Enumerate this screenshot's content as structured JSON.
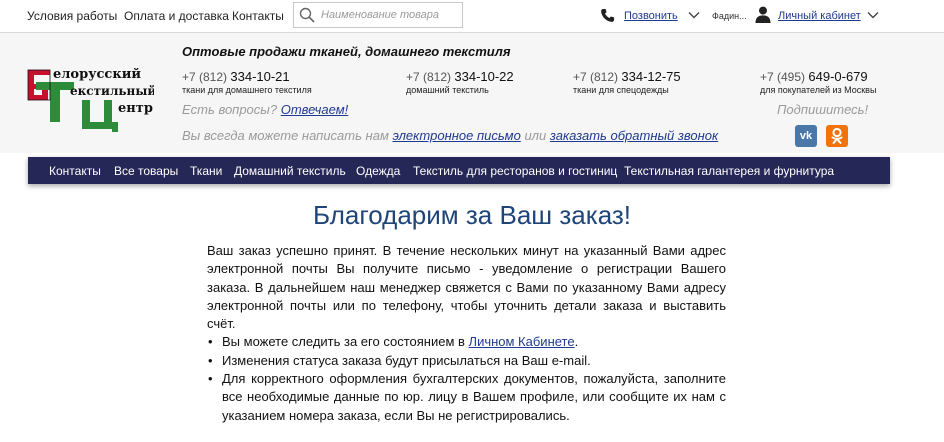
{
  "top_nav": {
    "links": [
      "Условия работы",
      "Оплата и доставка",
      "Контакты"
    ],
    "search_placeholder": "Наименование товара",
    "callback_label": "Позвонить",
    "user_name": "Фадин...",
    "cabinet_label": "Личный кабинет"
  },
  "header": {
    "logo_text": [
      "елорусский",
      "екстильный",
      "ентр"
    ],
    "tagline": "Оптовые продажи тканей, домашнего текстиля",
    "phones": [
      {
        "prefix": "+7 (812)",
        "number": "334-10-21",
        "desc": "ткани для домашнего текстиля"
      },
      {
        "prefix": "+7 (812)",
        "number": "334-10-22",
        "desc": "домашний текстиль"
      },
      {
        "prefix": "+7 (812)",
        "number": "334-12-75",
        "desc": "ткани для спецодежды"
      },
      {
        "prefix": "+7 (495)",
        "number": "649-0-679",
        "desc": "для покупателей из Москвы"
      }
    ],
    "questions_text": "Есть вопросы?",
    "questions_link": "Отвечаем!",
    "mail_prefix": "Вы всегда можете написать нам",
    "mail_link": "электронное письмо",
    "mail_or": "или",
    "callback_link": "заказать обратный звонок",
    "subscribe": "Подпишитесь!",
    "vk_label": "vk"
  },
  "nav": {
    "items": [
      "Контакты",
      "Все товары",
      "Ткани",
      "Домашний текстиль",
      "Одежда",
      "Текстиль для ресторанов и гостиниц",
      "Текстильная галантерея и фурнитура"
    ]
  },
  "main": {
    "title": "Благодарим за Ваш заказ!",
    "paragraph": "Ваш заказ успешно принят. В течение нескольких минут на указанный Вами адрес электронной почты Вы получите письмо - уведомление о регистрации Вашего заказа. В дальнейшем наш менеджер свяжется с Вами по указанному Вами адресу электронной почты или по телефону, чтобы уточнить детали заказа и выставить счёт.",
    "bullet1_prefix": "Вы можете следить за его состоянием в ",
    "bullet1_link": "Личном Кабинете",
    "bullet1_suffix": ".",
    "bullet2": "Изменения статуса заказа будут присылаться на Ваш e-mail.",
    "bullet3": "Для корректного оформления бухгалтерских документов, пожалуйста, заполните все необходимые данные по юр. лицу в Вашем профиле, или сообщите их нам с указанием номера заказа, если Вы не регистрировались."
  },
  "colors": {
    "nav_bg": "#252756",
    "title": "#1f4477",
    "link": "#1f3a93",
    "vk": "#4a76a8",
    "ok": "#f2720c"
  }
}
